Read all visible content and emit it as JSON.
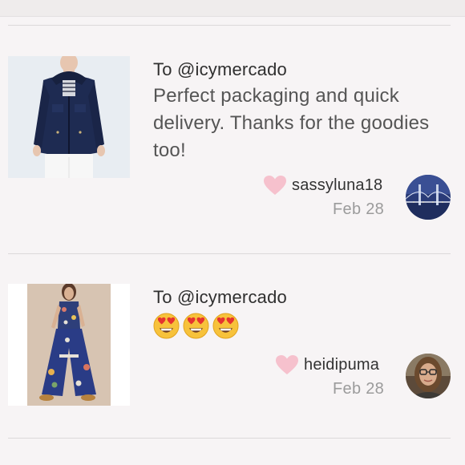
{
  "comments": [
    {
      "to": "To @icymercado",
      "message": "Perfect packaging and quick delivery. Thanks for the goodies too!",
      "username": "sassyluna18",
      "date": "Feb 28",
      "thumbnail_icon": "navy-jacket-photo",
      "avatar_icon": "bridge-night-photo"
    },
    {
      "to": "To @icymercado",
      "message_emojis": [
        "😍",
        "😍",
        "😍"
      ],
      "username": "heidipuma",
      "date": "Feb 28",
      "thumbnail_icon": "floral-jumpsuit-photo",
      "avatar_icon": "woman-portrait-photo"
    }
  ],
  "colors": {
    "background": "#f7f4f5",
    "heart": "#f6c1cd",
    "date": "#9b9b9b",
    "divider": "#dcd9da"
  }
}
